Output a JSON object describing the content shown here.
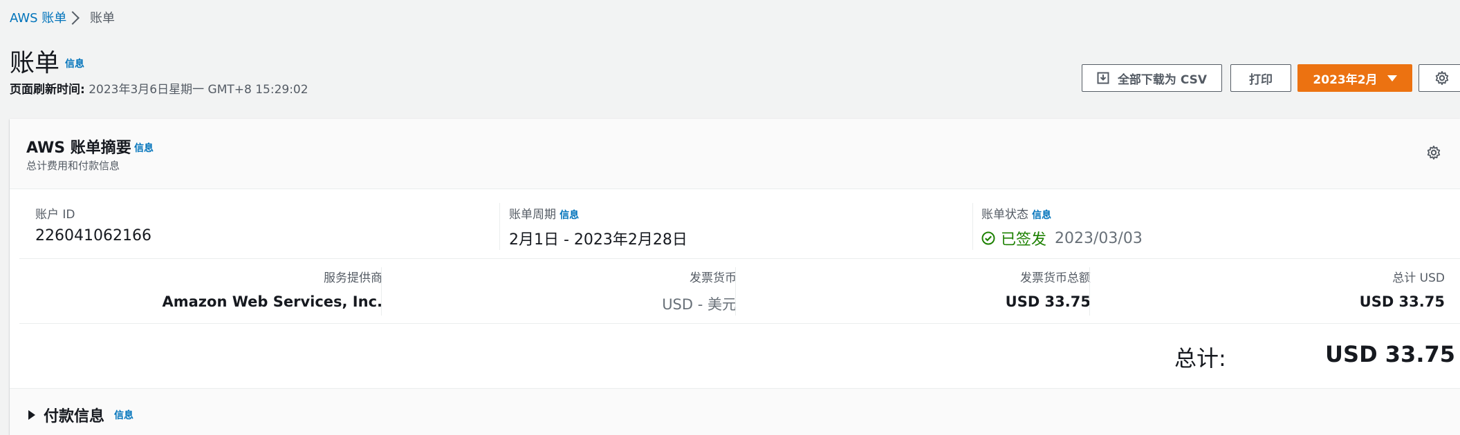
{
  "breadcrumb": {
    "root": "AWS 账单",
    "current": "账单"
  },
  "page": {
    "title": "账单",
    "info": "信息",
    "refresh_label": "页面刷新时间:",
    "refresh_value": "2023年3月6日星期一 GMT+8 15:29:02"
  },
  "actions": {
    "download_csv": "全部下载为 CSV",
    "print": "打印",
    "period_selector": "2023年2月"
  },
  "summary": {
    "title": "AWS 账单摘要",
    "info": "信息",
    "subtitle": "总计费用和付款信息",
    "account_id_label": "账户 ID",
    "account_id": "226041062166",
    "billing_period_label": "账单周期",
    "billing_period_info": "信息",
    "billing_period": "2月1日 - 2023年2月28日",
    "bill_status_label": "账单状态",
    "bill_status_info": "信息",
    "bill_status": "已签发",
    "bill_status_date": "2023/03/03",
    "provider_label": "服务提供商",
    "provider": "Amazon Web Services, Inc.",
    "invoice_currency_label": "发票货币",
    "invoice_currency": "USD - 美元",
    "invoice_total_label": "发票货币总额",
    "invoice_total": "USD 33.75",
    "total_usd_label": "总计 USD",
    "total_usd": "USD 33.75",
    "grand_total_label": "总计:",
    "grand_total": "USD 33.75"
  },
  "payment": {
    "title": "付款信息",
    "info": "信息"
  },
  "colors": {
    "accent": "#ec7211",
    "link": "#0073bb",
    "success": "#1d8102"
  }
}
